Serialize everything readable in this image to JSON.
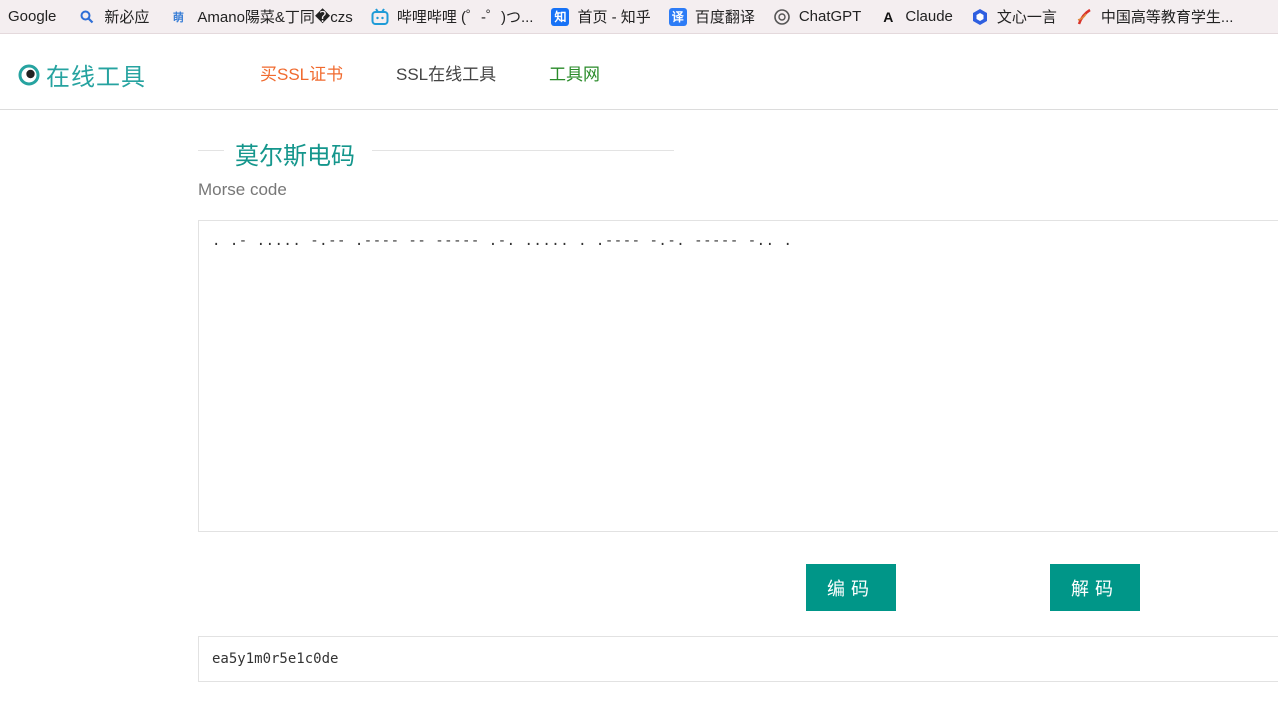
{
  "bookmarks": [
    {
      "label": "Google",
      "icon": ""
    },
    {
      "label": "新必应",
      "icon": "bing-search-icon"
    },
    {
      "label": "Amano陽菜&丁同�czs",
      "icon": "moegirl-icon"
    },
    {
      "label": "哔哩哔哩 (゜-゜)つ...",
      "icon": "bilibili-icon"
    },
    {
      "label": "首页 - 知乎",
      "icon": "zhihu-icon"
    },
    {
      "label": "百度翻译",
      "icon": "baidu-translate-icon"
    },
    {
      "label": "ChatGPT",
      "icon": "chatgpt-icon"
    },
    {
      "label": "Claude",
      "icon": "claude-icon"
    },
    {
      "label": "文心一言",
      "icon": "wenxin-icon"
    },
    {
      "label": "中国高等教育学生...",
      "icon": "chsi-icon"
    }
  ],
  "header": {
    "logo_text": "在线工具",
    "nav": {
      "ssl": "买SSL证书",
      "tools": "SSL在线工具",
      "net": "工具网"
    }
  },
  "main": {
    "title": "莫尔斯电码",
    "subtitle": "Morse code",
    "morse_input": ". .- ..... -.-- .---- -- ----- .-. ..... . .---- -.-. ----- -.. .",
    "encode_label": "编码",
    "decode_label": "解码",
    "result_value": "ea5y1m0r5e1c0de"
  },
  "colors": {
    "accent": "#009688",
    "title": "#14968c",
    "nav_ssl": "#f06a2e",
    "nav_net": "#2a8b2a"
  }
}
